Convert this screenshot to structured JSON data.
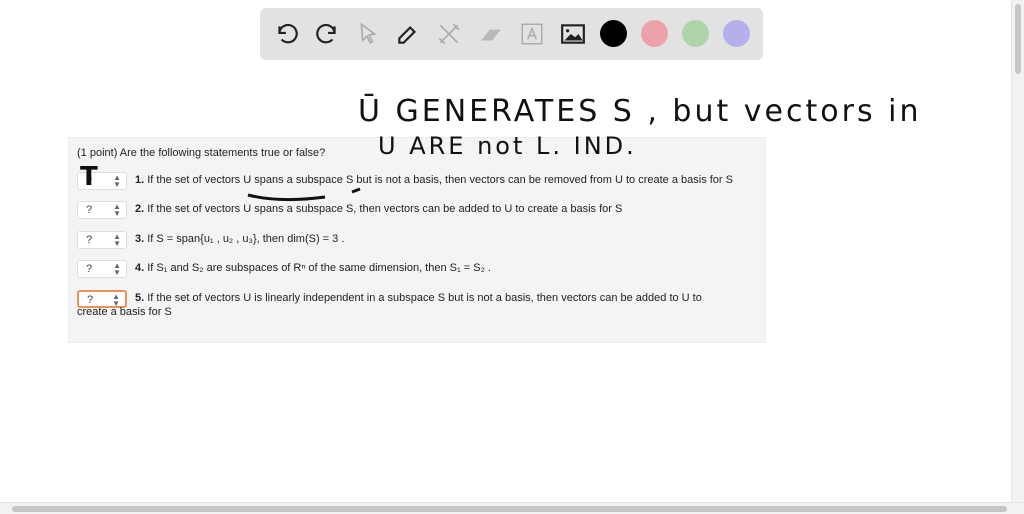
{
  "toolbar": {
    "tools": [
      "undo-icon",
      "redo-icon",
      "pointer-icon",
      "pen-icon",
      "tools-icon",
      "eraser-icon",
      "text-icon",
      "image-icon"
    ],
    "colors": [
      "#000000",
      "#eba2aa",
      "#aed5a9",
      "#b3b0ea"
    ]
  },
  "question": {
    "intro": "(1 point) Are the following statements true or false?",
    "placeholder": "?",
    "items": [
      {
        "num": "1.",
        "text": "If the set of vectors U spans a subspace S but is not a basis, then vectors can be removed from U to create a basis for S"
      },
      {
        "num": "2.",
        "text": "If the set of vectors U spans a subspace S, then vectors can be added to U to create a basis for S"
      },
      {
        "num": "3.",
        "text": "If S = span{u₁ , u₂ , u₃}, then dim(S) = 3 ."
      },
      {
        "num": "4.",
        "text": "If S₁ and S₂ are subspaces of Rⁿ of the same dimension, then S₁ = S₂ ."
      },
      {
        "num": "5.",
        "text": "If the set of vectors U is linearly independent in a subspace S but is not a basis, then vectors can be added to U to",
        "text2": "create a basis for S"
      }
    ]
  },
  "annotations": {
    "line1": "Ū GENERATES S , but vectors in",
    "line2": "U ARE not L. IND.",
    "answer1": "T"
  }
}
